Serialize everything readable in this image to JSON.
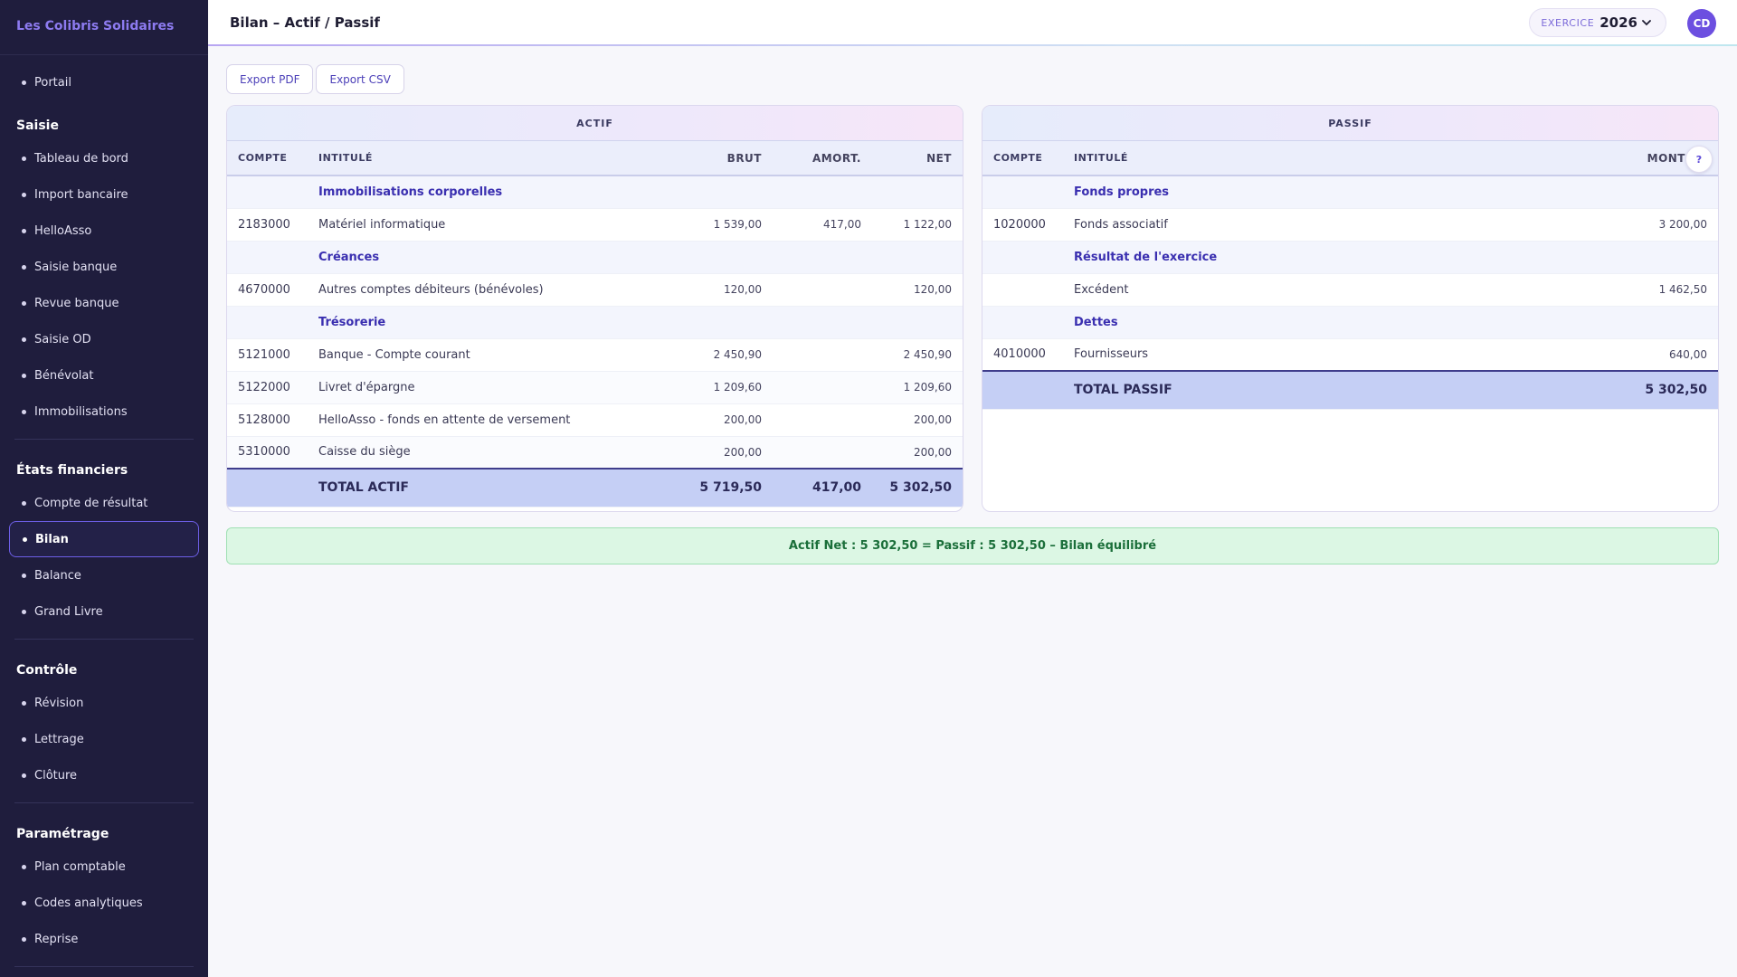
{
  "app": {
    "brand": "Les Colibris Solidaires"
  },
  "sidebar": {
    "top_item": "Portail",
    "sections": [
      {
        "title": "Saisie",
        "items": [
          "Tableau de bord",
          "Import bancaire",
          "HelloAsso",
          "Saisie banque",
          "Revue banque",
          "Saisie OD",
          "Bénévolat",
          "Immobilisations"
        ]
      },
      {
        "title": "États financiers",
        "items": [
          "Compte de résultat",
          "Bilan",
          "Balance",
          "Grand Livre"
        ],
        "active": "Bilan"
      },
      {
        "title": "Contrôle",
        "items": [
          "Révision",
          "Lettrage",
          "Clôture"
        ]
      },
      {
        "title": "Paramétrage",
        "items": [
          "Plan comptable",
          "Codes analytiques",
          "Reprise"
        ]
      }
    ]
  },
  "header": {
    "title": "Bilan – Actif / Passif",
    "exercice_label": "EXERCICE",
    "exercice_value": "2026",
    "avatar_initials": "CD"
  },
  "toolbar": {
    "export_pdf": "Export PDF",
    "export_csv": "Export CSV"
  },
  "actif": {
    "title": "ACTIF",
    "columns": [
      "COMPTE",
      "INTITULÉ",
      "BRUT",
      "AMORT.",
      "NET"
    ],
    "rows": [
      {
        "type": "group",
        "label": "Immobilisations corporelles"
      },
      {
        "type": "row",
        "compte": "2183000",
        "intitule": "Matériel informatique",
        "brut": "1 539,00",
        "amort": "417,00",
        "net": "1 122,00"
      },
      {
        "type": "group",
        "label": "Créances"
      },
      {
        "type": "row",
        "compte": "4670000",
        "intitule": "Autres comptes débiteurs (bénévoles)",
        "brut": "120,00",
        "amort": "",
        "net": "120,00"
      },
      {
        "type": "group",
        "label": "Trésorerie"
      },
      {
        "type": "row",
        "compte": "5121000",
        "intitule": "Banque - Compte courant",
        "brut": "2 450,90",
        "amort": "",
        "net": "2 450,90"
      },
      {
        "type": "row",
        "compte": "5122000",
        "intitule": "Livret d'épargne",
        "brut": "1 209,60",
        "amort": "",
        "net": "1 209,60"
      },
      {
        "type": "row",
        "compte": "5128000",
        "intitule": "HelloAsso - fonds en attente de versement",
        "brut": "200,00",
        "amort": "",
        "net": "200,00"
      },
      {
        "type": "row",
        "compte": "5310000",
        "intitule": "Caisse du siège",
        "brut": "200,00",
        "amort": "",
        "net": "200,00"
      }
    ],
    "total": {
      "label": "TOTAL ACTIF",
      "brut": "5 719,50",
      "amort": "417,00",
      "net": "5 302,50"
    }
  },
  "passif": {
    "title": "PASSIF",
    "columns": [
      "COMPTE",
      "INTITULÉ",
      "MONT"
    ],
    "rows": [
      {
        "type": "group",
        "label": "Fonds propres"
      },
      {
        "type": "row",
        "compte": "1020000",
        "intitule": "Fonds associatif",
        "montant": "3 200,00"
      },
      {
        "type": "group",
        "label": "Résultat de l'exercice"
      },
      {
        "type": "row",
        "compte": "",
        "intitule": "Excédent",
        "montant": "1 462,50"
      },
      {
        "type": "group",
        "label": "Dettes"
      },
      {
        "type": "row",
        "compte": "4010000",
        "intitule": "Fournisseurs",
        "montant": "640,00"
      }
    ],
    "total": {
      "label": "TOTAL PASSIF",
      "montant": "5 302,50"
    },
    "help_icon": "?"
  },
  "balance_message": "Actif Net : 5 302,50 = Passif : 5 302,50 – Bilan équilibré"
}
